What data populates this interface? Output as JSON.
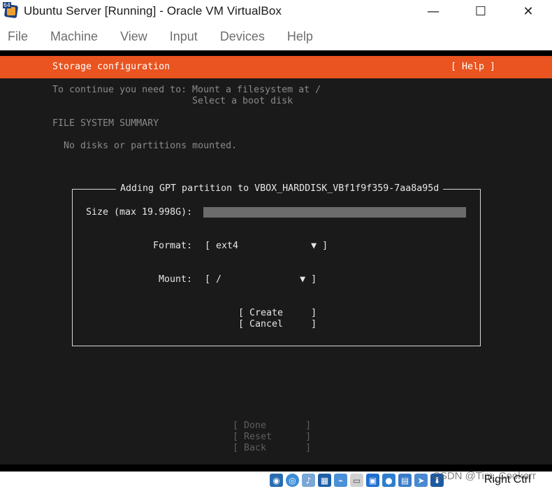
{
  "window": {
    "title": "Ubuntu Server [Running] - Oracle VM VirtualBox",
    "icon_tag": "64",
    "controls": [
      "—",
      "☐",
      "✕"
    ]
  },
  "menu": [
    "File",
    "Machine",
    "View",
    "Input",
    "Devices",
    "Help"
  ],
  "installer": {
    "header_title": "Storage configuration",
    "help_label": "[ Help ]",
    "instruction_prefix": "To continue you need to:",
    "instruction_1": "Mount a filesystem at /",
    "instruction_2": "Select a boot disk",
    "fs_summary_heading": "FILE SYSTEM SUMMARY",
    "fs_summary_empty": "No disks or partitions mounted.",
    "dialog": {
      "title": "Adding GPT partition to VBOX_HARDDISK_VBf1f9f359-7aa8a95d",
      "size_label": "Size (max 19.998G):",
      "size_value": "",
      "format_label": "Format:",
      "format_value": "[ ext4             ▼ ]",
      "mount_label": "Mount:",
      "mount_value": "[ /              ▼ ]",
      "create_button": "[ Create     ]",
      "cancel_button": "[ Cancel     ]"
    },
    "done_button": "[ Done       ]",
    "reset_button": "[ Reset      ]",
    "back_button": "[ Back       ]"
  },
  "statusbar": {
    "host_key": "Right Ctrl",
    "watermark": "CSDN @Tim_Cookerr",
    "icons": [
      "hard-disk-icon",
      "optical-disk-icon",
      "audio-icon",
      "network-icon",
      "usb-icon",
      "shared-folders-icon",
      "display-icon",
      "video-capture-icon",
      "cpu-icon",
      "mouse-integration-icon",
      "keyboard-icon"
    ]
  },
  "colors": {
    "header_accent": "#e95420",
    "terminal_bg": "#1a1a1a"
  }
}
